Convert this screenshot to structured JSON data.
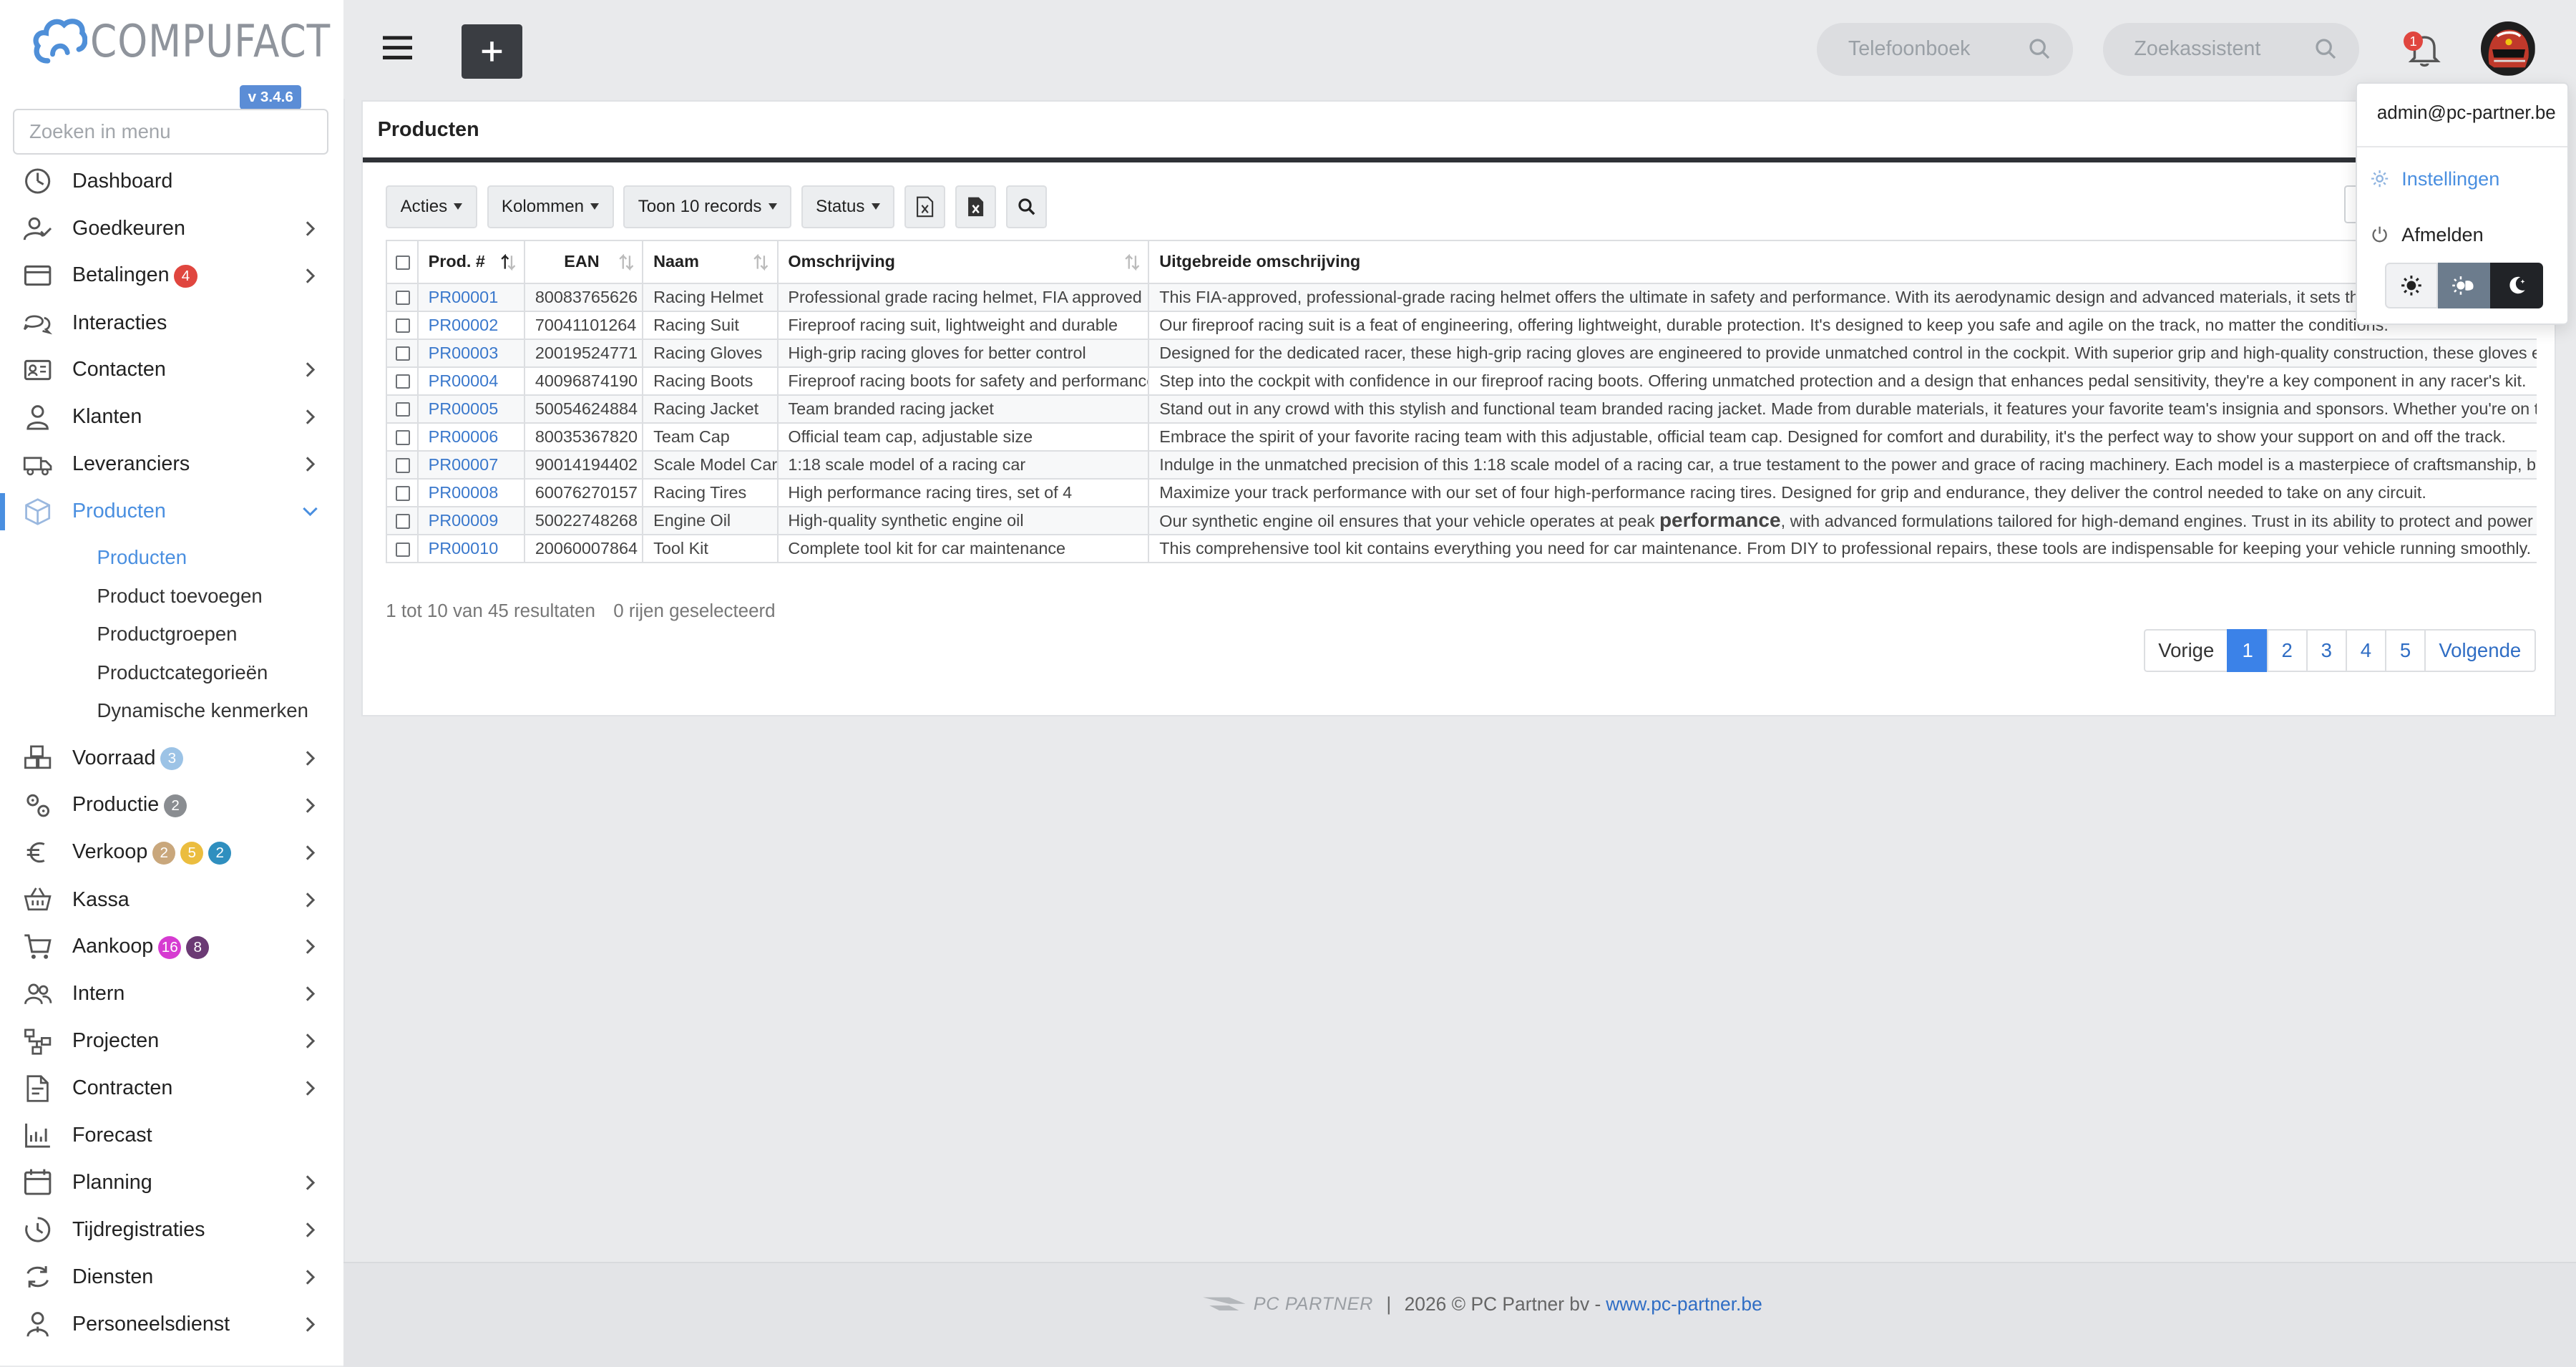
{
  "app": {
    "logo_text": "COMPUFACT",
    "version": "v 3.4.6"
  },
  "sidebar": {
    "search_placeholder": "Zoeken in menu",
    "items": [
      {
        "label": "Dashboard",
        "icon": "dashboard-icon",
        "chevron": false
      },
      {
        "label": "Goedkeuren",
        "icon": "user-check-icon",
        "chevron": true
      },
      {
        "label": "Betalingen",
        "icon": "credit-card-icon",
        "chevron": true,
        "badges": [
          {
            "text": "4",
            "color": "#e0463f"
          }
        ]
      },
      {
        "label": "Interacties",
        "icon": "chat-icon",
        "chevron": false
      },
      {
        "label": "Contacten",
        "icon": "contact-card-icon",
        "chevron": true
      },
      {
        "label": "Klanten",
        "icon": "customer-icon",
        "chevron": true
      },
      {
        "label": "Leveranciers",
        "icon": "truck-icon",
        "chevron": true
      },
      {
        "label": "Producten",
        "icon": "box-icon",
        "chevron": true,
        "expanded": true,
        "active": true
      }
    ],
    "sub_items": [
      "Producten",
      "Product toevoegen",
      "Productgroepen",
      "Productcategorieën",
      "Dynamische kenmerken"
    ],
    "items_after": [
      {
        "label": "Voorraad",
        "icon": "stock-icon",
        "chevron": true,
        "badges": [
          {
            "text": "3",
            "color": "#9cc3e6"
          }
        ]
      },
      {
        "label": "Productie",
        "icon": "gears-icon",
        "chevron": true,
        "badges": [
          {
            "text": "2",
            "color": "#8a8d91"
          }
        ]
      },
      {
        "label": "Verkoop",
        "icon": "euro-icon",
        "chevron": true,
        "badges": [
          {
            "text": "2",
            "color": "#c9a77c"
          },
          {
            "text": "5",
            "color": "#ebbd3f"
          },
          {
            "text": "2",
            "color": "#2f8fbf"
          }
        ]
      },
      {
        "label": "Kassa",
        "icon": "basket-icon",
        "chevron": true
      },
      {
        "label": "Aankoop",
        "icon": "cart-icon",
        "chevron": true,
        "badges": [
          {
            "text": "16",
            "color": "#d63bd1"
          },
          {
            "text": "8",
            "color": "#6b3a74"
          }
        ]
      },
      {
        "label": "Intern",
        "icon": "people-icon",
        "chevron": true
      },
      {
        "label": "Projecten",
        "icon": "project-icon",
        "chevron": true
      },
      {
        "label": "Contracten",
        "icon": "contract-icon",
        "chevron": true
      },
      {
        "label": "Forecast",
        "icon": "forecast-icon",
        "chevron": false
      },
      {
        "label": "Planning",
        "icon": "calendar-icon",
        "chevron": true
      },
      {
        "label": "Tijdregistraties",
        "icon": "clock-icon",
        "chevron": true
      },
      {
        "label": "Diensten",
        "icon": "refresh-icon",
        "chevron": true
      },
      {
        "label": "Personeelsdienst",
        "icon": "staff-icon",
        "chevron": true
      }
    ]
  },
  "topbar": {
    "phonebook_placeholder": "Telefoonboek",
    "assistant_placeholder": "Zoekassistent",
    "notification_count": "1"
  },
  "page": {
    "title": "Producten",
    "toolbar": {
      "actions": "Acties",
      "columns": "Kolommen",
      "show_records": "Toon 10 records",
      "status": "Status"
    },
    "columns": [
      "Prod. #",
      "EAN",
      "Naam",
      "Omschrijving",
      "Uitgebreide omschrijving"
    ],
    "rows": [
      {
        "id": "PR00001",
        "ean": "80083765626",
        "name": "Racing Helmet",
        "desc": "Professional grade racing helmet, FIA approved",
        "long": "This FIA-approved, professional-grade racing helmet offers the ultimate in safety and performance. With its aerodynamic design and advanced materials, it sets the standard"
      },
      {
        "id": "PR00002",
        "ean": "70041101264",
        "name": "Racing Suit",
        "desc": "Fireproof racing suit, lightweight and durable",
        "long": "Our fireproof racing suit is a feat of engineering, offering lightweight, durable protection. It's designed to keep you safe and agile on the track, no matter the conditions."
      },
      {
        "id": "PR00003",
        "ean": "20019524771",
        "name": "Racing Gloves",
        "desc": "High-grip racing gloves for better control",
        "long": "Designed for the dedicated racer, these high-grip racing gloves are engineered to provide unmatched control in the cockpit. With superior grip and high-quality construction, these gloves enhance you"
      },
      {
        "id": "PR00004",
        "ean": "40096874190",
        "name": "Racing Boots",
        "desc": "Fireproof racing boots for safety and performance",
        "long": "Step into the cockpit with confidence in our fireproof racing boots. Offering unmatched protection and a design that enhances pedal sensitivity, they're a key component in any racer's kit."
      },
      {
        "id": "PR00005",
        "ean": "50054624884",
        "name": "Racing Jacket",
        "desc": "Team branded racing jacket",
        "long": "Stand out in any crowd with this stylish and functional team branded racing jacket. Made from durable materials, it features your favorite team's insignia and sponsors. Whether you're on the track or"
      },
      {
        "id": "PR00006",
        "ean": "80035367820",
        "name": "Team Cap",
        "desc": "Official team cap, adjustable size",
        "long": "Embrace the spirit of your favorite racing team with this adjustable, official team cap. Designed for comfort and durability, it's the perfect way to show your support on and off the track."
      },
      {
        "id": "PR00007",
        "ean": "90014194402",
        "name": "Scale Model Car",
        "desc": "1:18 scale model of a racing car",
        "long": "Indulge in the unmatched precision of this 1:18 scale model of a racing car, a true testament to the power and grace of racing machinery. Each model is a masterpiece of craftsmanship, boasting au"
      },
      {
        "id": "PR00008",
        "ean": "60076270157",
        "name": "Racing Tires",
        "desc": "High performance racing tires, set of 4",
        "long": "Maximize your track performance with our set of four high-performance racing tires. Designed for grip and endurance, they deliver the control needed to take on any circuit."
      },
      {
        "id": "PR00009",
        "ean": "50022748268",
        "name": "Engine Oil",
        "desc": "High-quality synthetic engine oil",
        "long_a": "Our synthetic engine oil ensures that your vehicle operates at peak ",
        "long_b": "performance",
        "long_c": ", with advanced formulations tailored for high-demand engines. Trust in its ability to protect and power your drive."
      },
      {
        "id": "PR00010",
        "ean": "20060007864",
        "name": "Tool Kit",
        "desc": "Complete tool kit for car maintenance",
        "long": "This comprehensive tool kit contains everything you need for car maintenance. From DIY to professional repairs, these tools are indispensable for keeping your vehicle running smoothly."
      }
    ],
    "info_results": "1 tot 10 van 45 resultaten",
    "info_selected": "0 rijen geselecteerd",
    "pagination": {
      "prev": "Vorige",
      "pages": [
        "1",
        "2",
        "3",
        "4",
        "5"
      ],
      "current": "1",
      "next": "Volgende"
    }
  },
  "footer": {
    "logo": "PC PARTNER",
    "separator": "|",
    "copyright": "2026 © PC Partner bv - ",
    "link": "www.pc-partner.be"
  },
  "user_menu": {
    "email": "admin@pc-partner.be",
    "settings": "Instellingen",
    "logout": "Afmelden",
    "theme_options": [
      "light-theme-icon",
      "auto-theme-icon",
      "dark-theme-icon"
    ]
  }
}
